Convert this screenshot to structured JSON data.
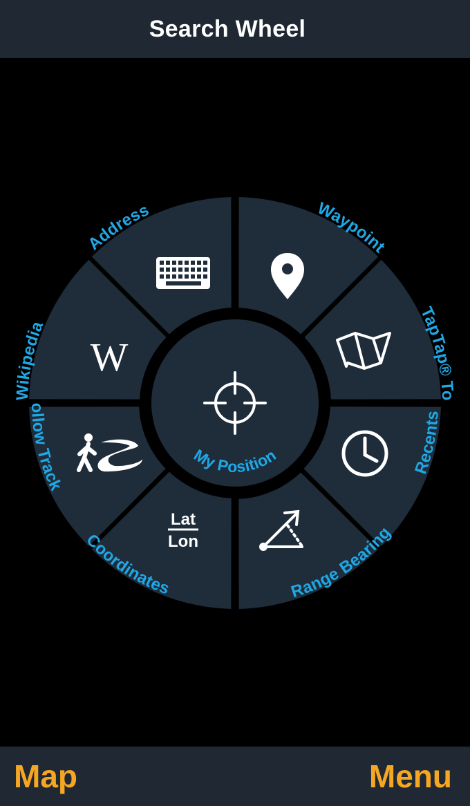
{
  "header": {
    "title": "Search Wheel"
  },
  "colors": {
    "background": "#000000",
    "bar": "#1f2833",
    "wheel_segment": "#1f2c3a",
    "label": "#1fa8e6",
    "accent": "#f5a623",
    "icon": "#ffffff"
  },
  "wheel": {
    "center": {
      "label": "My Position",
      "icon": "crosshair-icon"
    },
    "segments": [
      {
        "label": "Waypoint",
        "icon": "map-pin-icon"
      },
      {
        "label": "TapTap® Tool",
        "icon": "folded-map-icon"
      },
      {
        "label": "Recents",
        "icon": "clock-icon"
      },
      {
        "label": "Range Bearing",
        "icon": "range-bearing-icon"
      },
      {
        "label": "Coordinates",
        "icon": "lat-lon-icon",
        "icon_text_top": "Lat",
        "icon_text_bottom": "Lon"
      },
      {
        "label": "Follow Track",
        "icon": "hiker-track-icon"
      },
      {
        "label": "Wikipedia",
        "icon": "wikipedia-icon",
        "icon_text": "W"
      },
      {
        "label": "Address",
        "icon": "keyboard-icon"
      }
    ]
  },
  "footer": {
    "left_label": "Map",
    "right_label": "Menu"
  }
}
